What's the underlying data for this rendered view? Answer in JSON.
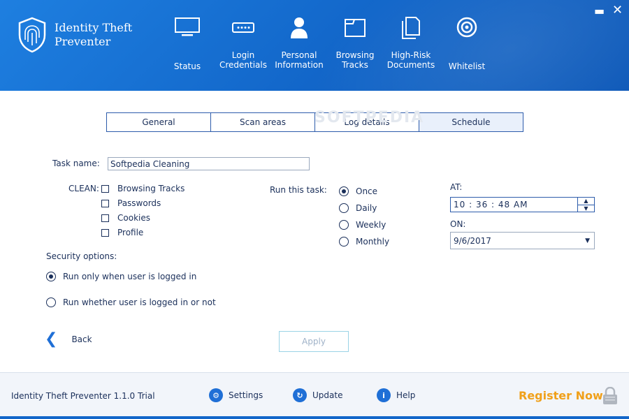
{
  "app": {
    "name": "Identity Theft Preventer",
    "version_text": "Identity Theft Preventer 1.1.0 Trial"
  },
  "nav": [
    {
      "label": "Status",
      "icon": "monitor-icon"
    },
    {
      "label": "Login\nCredentials",
      "icon": "password-field-icon"
    },
    {
      "label": "Personal\nInformation",
      "icon": "user-icon"
    },
    {
      "label": "Browsing\nTracks",
      "icon": "browser-window-icon"
    },
    {
      "label": "High-Risk\nDocuments",
      "icon": "documents-icon"
    },
    {
      "label": "Whitelist",
      "icon": "target-icon"
    }
  ],
  "tabs": [
    {
      "label": "General"
    },
    {
      "label": "Scan areas"
    },
    {
      "label": "Log details"
    },
    {
      "label": "Schedule"
    }
  ],
  "watermark": "SOFTPEDIA",
  "form": {
    "task_name_label": "Task name:",
    "task_name_value": "Softpedia Cleaning",
    "clean_label": "CLEAN:",
    "clean_items": [
      "Browsing Tracks",
      "Passwords",
      "Cookies",
      "Profile"
    ],
    "run_label": "Run this task:",
    "run_options": [
      "Once",
      "Daily",
      "Weekly",
      "Monthly"
    ],
    "run_selected": "Once",
    "at_label": "AT:",
    "time_value": "10 : 36 : 48  AM",
    "on_label": "ON:",
    "date_value": "9/6/2017",
    "security_label": "Security options:",
    "security_options": [
      "Run only when user is logged in",
      "Run whether user is logged in or not"
    ],
    "security_selected": "Run only when user is logged in",
    "back_label": "Back",
    "apply_label": "Apply"
  },
  "footer": {
    "settings_label": "Settings",
    "update_label": "Update",
    "help_label": "Help",
    "register_label": "Register Now"
  },
  "colors": {
    "header_blue": "#1266c9",
    "text_navy": "#1a2f5a",
    "accent_orange": "#f0a01a"
  }
}
